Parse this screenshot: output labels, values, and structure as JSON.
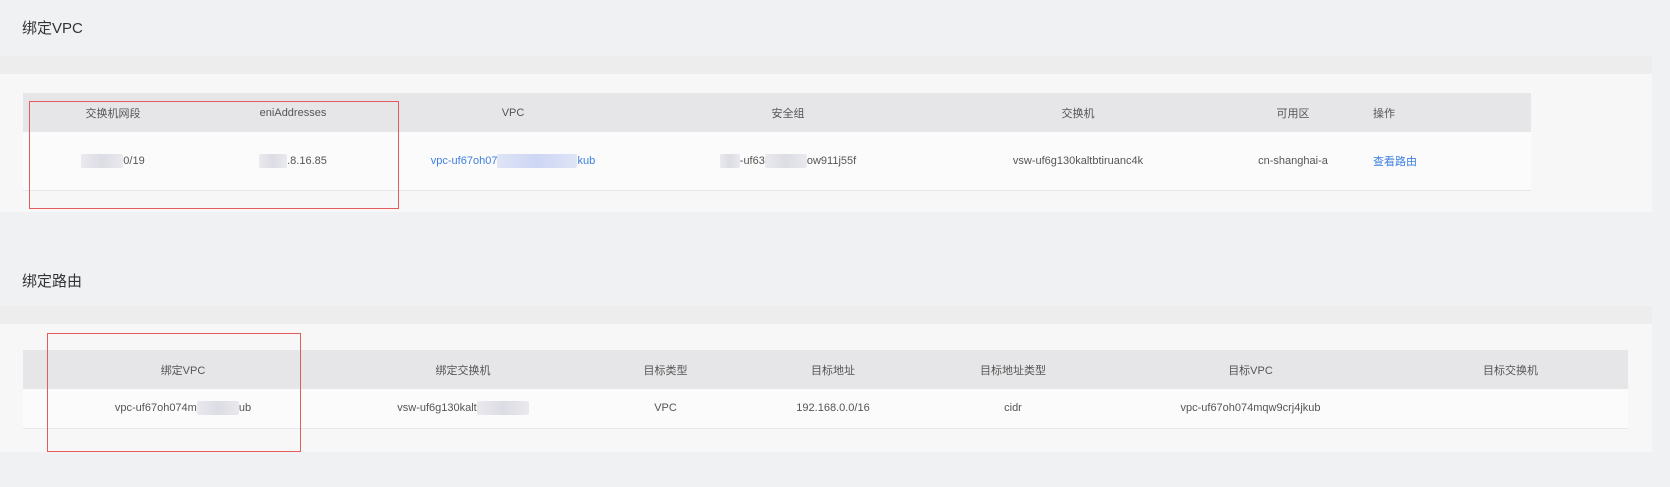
{
  "vpc_section": {
    "title": "绑定VPC",
    "columns": [
      "交换机网段",
      "eniAddresses",
      "VPC",
      "安全组",
      "交换机",
      "可用区",
      "操作"
    ],
    "row": {
      "cidr_suffix": "0/19",
      "eni_suffix": ".8.16.85",
      "vpc_prefix": "vpc-uf67oh07",
      "vpc_suffix": "kub",
      "sg_prefix": "-uf63",
      "sg_suffix": "ow911j55f",
      "vswitch": "vsw-uf6g130kaltbtiruanc4k",
      "zone": "cn-shanghai-a",
      "action": "查看路由"
    }
  },
  "route_section": {
    "title": "绑定路由",
    "columns": [
      "绑定VPC",
      "绑定交换机",
      "目标类型",
      "目标地址",
      "目标地址类型",
      "目标VPC",
      "目标交换机"
    ],
    "row": {
      "vpc_prefix": "vpc-uf67oh074m",
      "vpc_suffix": "ub",
      "vswitch_prefix": "vsw-uf6g130kalt",
      "target_type": "VPC",
      "target_address": "192.168.0.0/16",
      "target_address_type": "cidr",
      "target_vpc": "vpc-uf67oh074mqw9crj4jkub",
      "target_vswitch": ""
    }
  },
  "colors": {
    "accent_link": "#3d7fe0",
    "highlight_border": "#e55a5a"
  }
}
